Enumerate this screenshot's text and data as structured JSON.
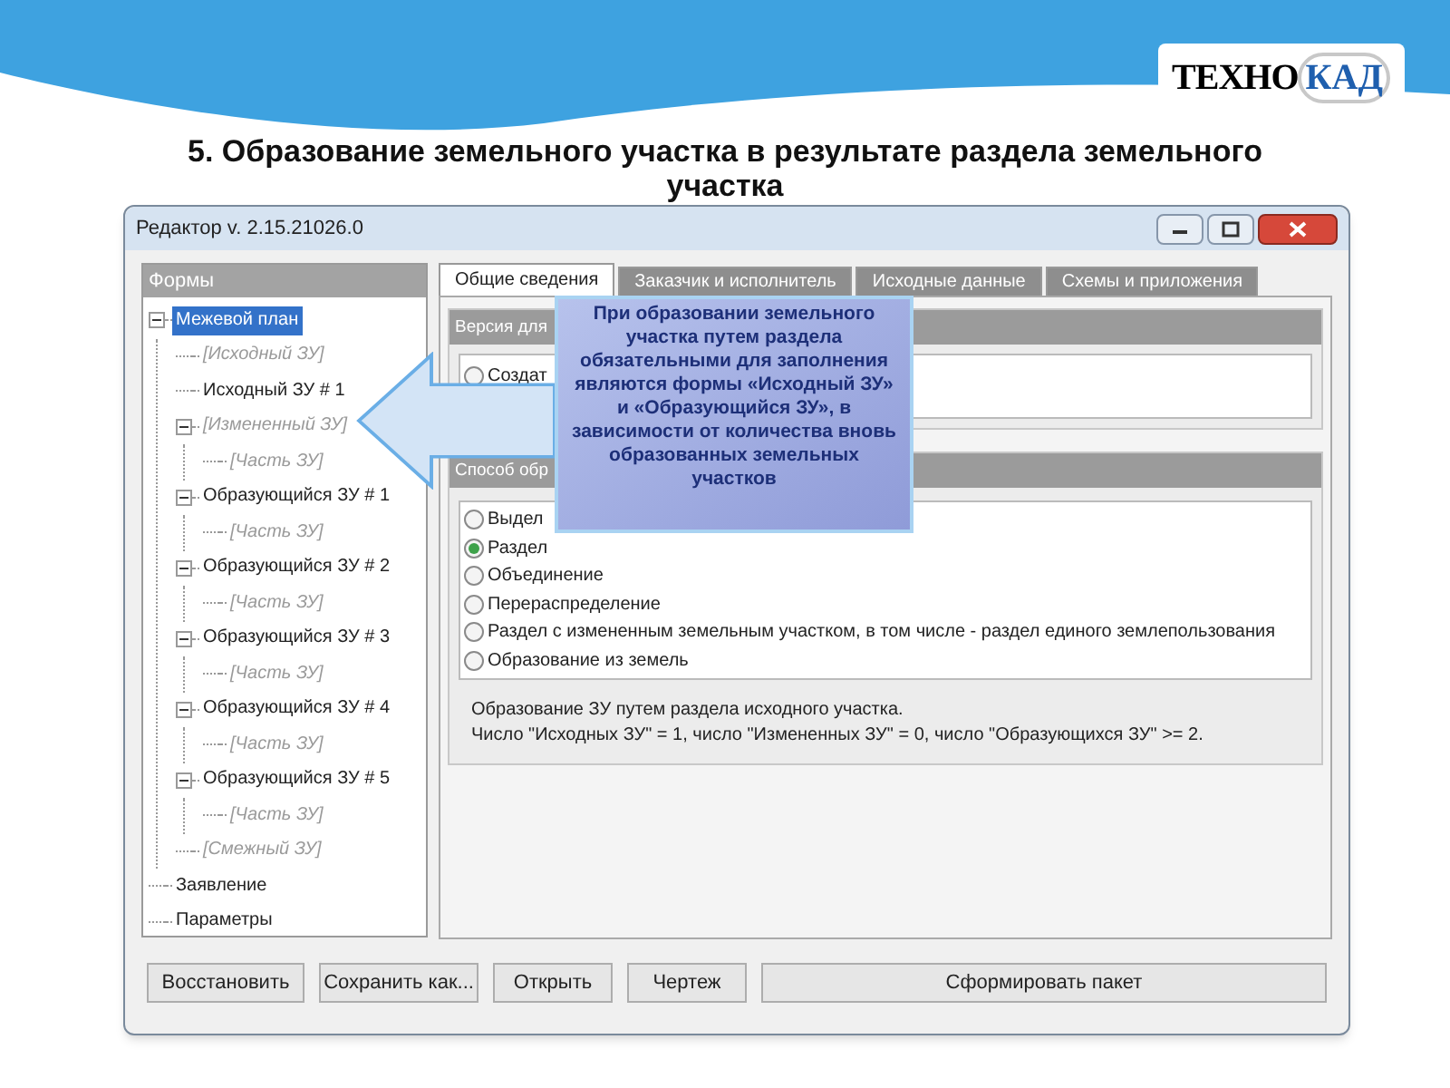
{
  "logo": {
    "part_1": "ТЕХНО",
    "part_2": "КАД"
  },
  "slide_title": "5. Образование земельного участка в результате раздела земельного участка",
  "window": {
    "title": "Редактор v. 2.15.21026.0"
  },
  "forms_panel": {
    "header": "Формы",
    "tree": [
      {
        "label": "Межевой план",
        "kind": "form",
        "selected": true,
        "expanded": true,
        "children": [
          {
            "label": "[Исходный ЗУ]",
            "kind": "template",
            "selected": false
          },
          {
            "label": "Исходный ЗУ # 1",
            "kind": "form",
            "selected": false
          },
          {
            "label": "[Измененный ЗУ]",
            "kind": "template",
            "selected": false,
            "expanded": true,
            "children": [
              {
                "label": "[Часть ЗУ]",
                "kind": "template",
                "selected": false
              }
            ]
          },
          {
            "label": "Образующийся ЗУ # 1",
            "kind": "form",
            "selected": false,
            "expanded": true,
            "children": [
              {
                "label": "[Часть ЗУ]",
                "kind": "template",
                "selected": false
              }
            ]
          },
          {
            "label": "Образующийся ЗУ # 2",
            "kind": "form",
            "selected": false,
            "expanded": true,
            "children": [
              {
                "label": "[Часть ЗУ]",
                "kind": "template",
                "selected": false
              }
            ]
          },
          {
            "label": "Образующийся ЗУ # 3",
            "kind": "form",
            "selected": false,
            "expanded": true,
            "children": [
              {
                "label": "[Часть ЗУ]",
                "kind": "template",
                "selected": false
              }
            ]
          },
          {
            "label": "Образующийся ЗУ # 4",
            "kind": "form",
            "selected": false,
            "expanded": true,
            "children": [
              {
                "label": "[Часть ЗУ]",
                "kind": "template",
                "selected": false
              }
            ]
          },
          {
            "label": "Образующийся ЗУ # 5",
            "kind": "form",
            "selected": false,
            "expanded": true,
            "children": [
              {
                "label": "[Часть ЗУ]",
                "kind": "template",
                "selected": false
              }
            ]
          },
          {
            "label": "[Смежный ЗУ]",
            "kind": "template",
            "selected": false
          }
        ]
      },
      {
        "label": "Заявление",
        "kind": "form",
        "selected": false
      },
      {
        "label": "Параметры",
        "kind": "form",
        "selected": false
      }
    ]
  },
  "tabs": [
    {
      "label": "Общие сведения",
      "selected": true
    },
    {
      "label": "Заказчик и исполнитель",
      "selected": false
    },
    {
      "label": "Исходные данные",
      "selected": false
    },
    {
      "label": "Схемы и приложения",
      "selected": false
    }
  ],
  "version_group": {
    "header": "Версия для",
    "options": [
      {
        "label": "Создат",
        "selected": false
      }
    ]
  },
  "method_group": {
    "header": "Способ обр",
    "options": [
      {
        "label": "Выдел",
        "selected": false
      },
      {
        "label": "Раздел",
        "selected": true
      },
      {
        "label": "Объединение",
        "selected": false
      },
      {
        "label": "Перераспределение",
        "selected": false
      },
      {
        "label": "Раздел с измененным земельным участком, в том числе - раздел единого землепользования",
        "selected": false
      },
      {
        "label": "Образование из земель",
        "selected": false
      }
    ],
    "description": [
      "Образование ЗУ путем раздела исходного участка.",
      "Число \"Исходных ЗУ\" = 1, число \"Измененных ЗУ\" = 0, число \"Образующихся ЗУ\" >= 2."
    ]
  },
  "buttons": [
    "Восстановить",
    "Сохранить как...",
    "Открыть",
    "Чертеж",
    "Сформировать пакет"
  ],
  "callout": "При образовании земельного участка путем раздела обязательными для заполнения являются формы «Исходный ЗУ» и «Образующийся ЗУ», в зависимости от количества вновь образованных земельных участков"
}
